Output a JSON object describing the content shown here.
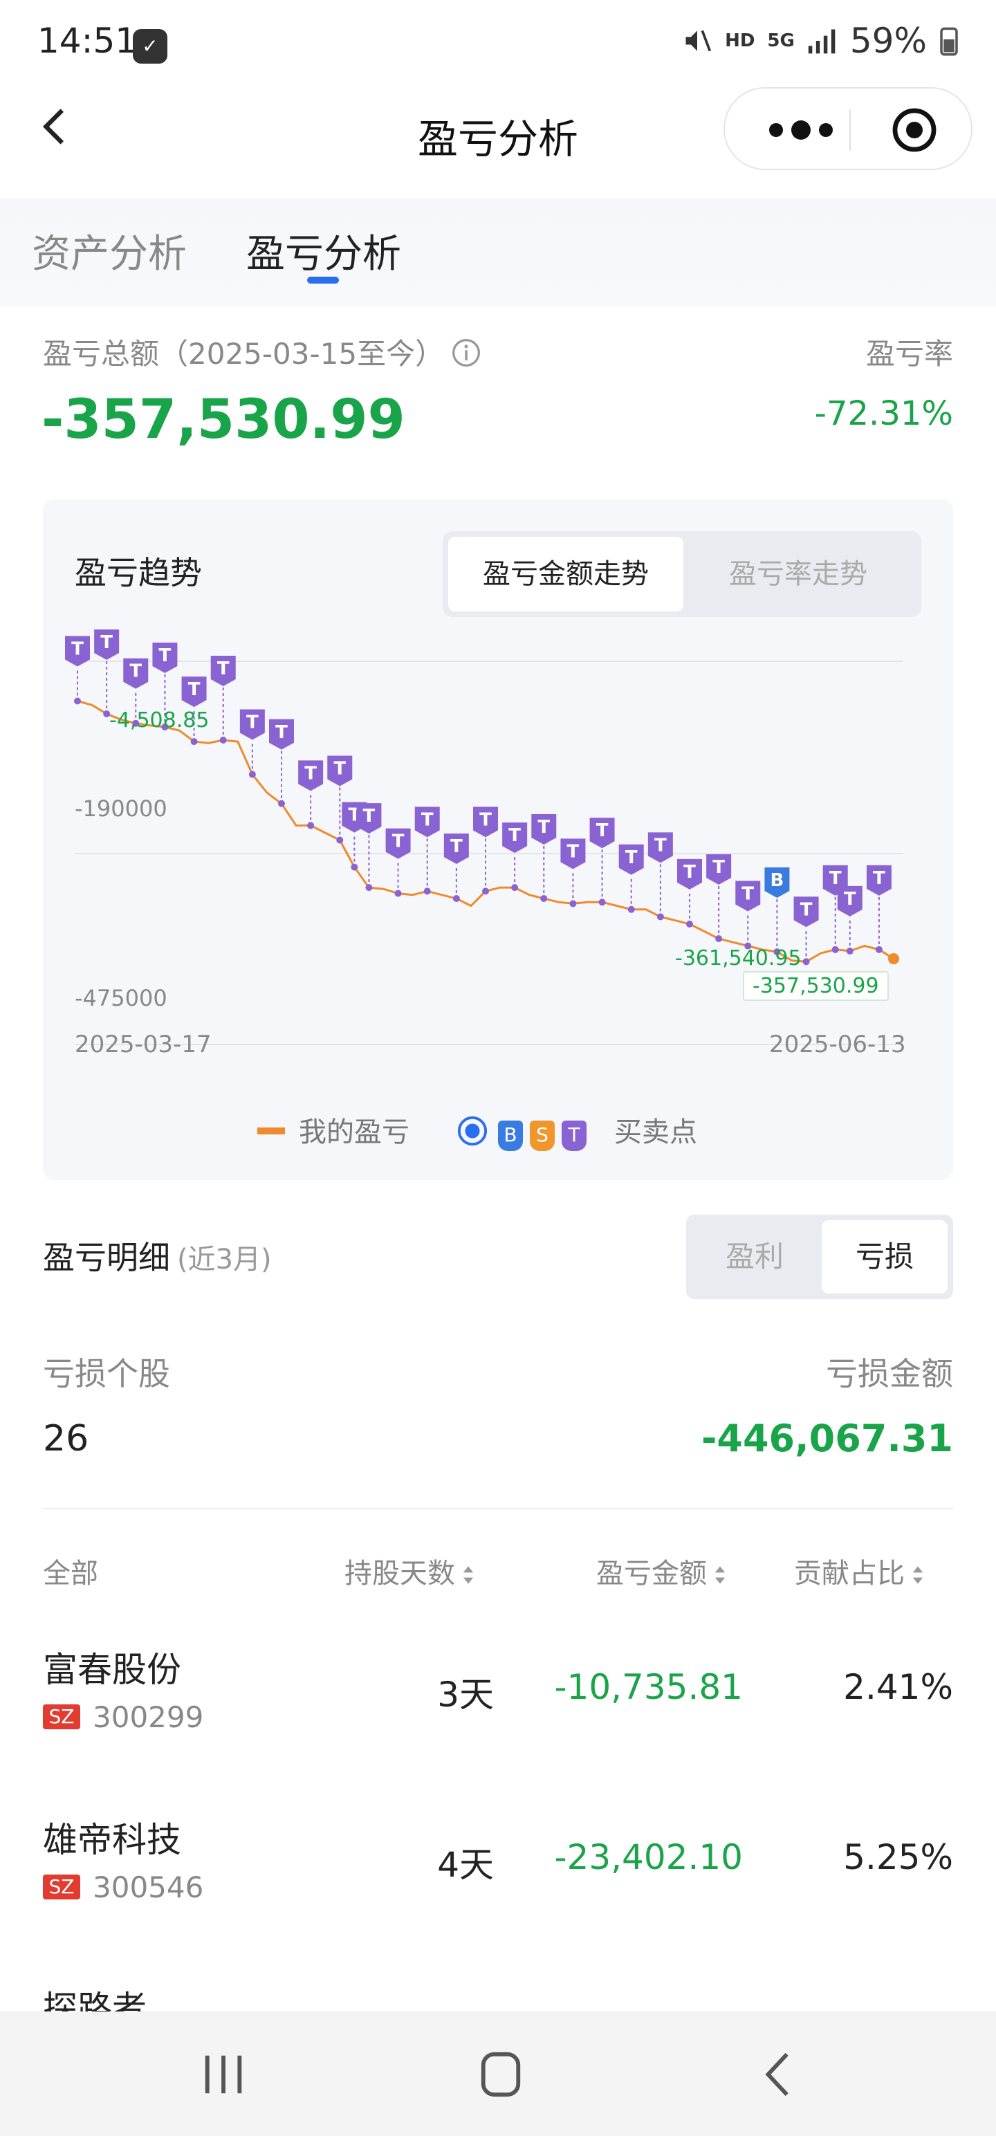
{
  "status_bar": {
    "time": "14:51",
    "network": "HD",
    "signal_type": "5G",
    "battery": "59%"
  },
  "header": {
    "title": "盈亏分析"
  },
  "tabs": [
    {
      "label": "资产分析"
    },
    {
      "label": "盈亏分析"
    }
  ],
  "summary": {
    "total_label": "盈亏总额（2025-03-15至今）",
    "total_value": "-357,530.99",
    "rate_label": "盈亏率",
    "rate_value": "-72.31%"
  },
  "trend": {
    "title": "盈亏趋势",
    "seg_amount": "盈亏金额走势",
    "seg_rate": "盈亏率走势",
    "legend_line": "我的盈亏",
    "legend_points": "买卖点",
    "marker_b": "B",
    "marker_s": "S",
    "marker_t": "T"
  },
  "chart_data": {
    "type": "line",
    "x_start": "2025-03-17",
    "x_end": "2025-06-13",
    "yticks": [
      "-190000",
      "-475000"
    ],
    "series": [
      {
        "name": "我的盈亏",
        "color": "#f08a2a"
      }
    ],
    "values": [
      -4508.85,
      -10000,
      -22000,
      -30000,
      -35000,
      -38000,
      -40000,
      -45000,
      -60000,
      -62000,
      -58000,
      -60000,
      -105000,
      -130000,
      -145000,
      -175000,
      -175000,
      -185000,
      -195000,
      -232000,
      -260000,
      -262000,
      -268000,
      -270000,
      -265000,
      -270000,
      -275000,
      -285000,
      -265000,
      -260000,
      -260000,
      -270000,
      -275000,
      -280000,
      -282000,
      -280000,
      -280000,
      -285000,
      -290000,
      -290000,
      -300000,
      -305000,
      -310000,
      -320000,
      -330000,
      -335000,
      -340000,
      -345000,
      -348000,
      -360000,
      -361540.95,
      -350000,
      -345000,
      -347000,
      -340000,
      -345000,
      -357530.99
    ],
    "labels": {
      "first": "-4,508.85",
      "min": "-361,540.95",
      "last": "-357,530.99"
    }
  },
  "detail": {
    "title": "盈亏明细",
    "subtitle": "(近3月)",
    "filter_profit": "盈利",
    "filter_loss": "亏损",
    "loss_stock_label": "亏损个股",
    "loss_amount_label": "亏损金额",
    "loss_stock_count": "26",
    "loss_amount_value": "-446,067.31"
  },
  "table": {
    "headers": {
      "all": "全部",
      "days": "持股天数",
      "pnl": "盈亏金额",
      "share": "贡献占比"
    },
    "rows": [
      {
        "name": "富春股份",
        "market": "SZ",
        "code": "300299",
        "days": "3天",
        "pnl": "-10,735.81",
        "share": "2.41%"
      },
      {
        "name": "雄帝科技",
        "market": "SZ",
        "code": "300546",
        "days": "4天",
        "pnl": "-23,402.10",
        "share": "5.25%"
      },
      {
        "name": "探路者"
      }
    ]
  },
  "colors": {
    "profit_green": "#1aa449",
    "accent_blue": "#2a6ef0",
    "line_orange": "#f08a2a",
    "marker_purple": "#8a63d2"
  }
}
